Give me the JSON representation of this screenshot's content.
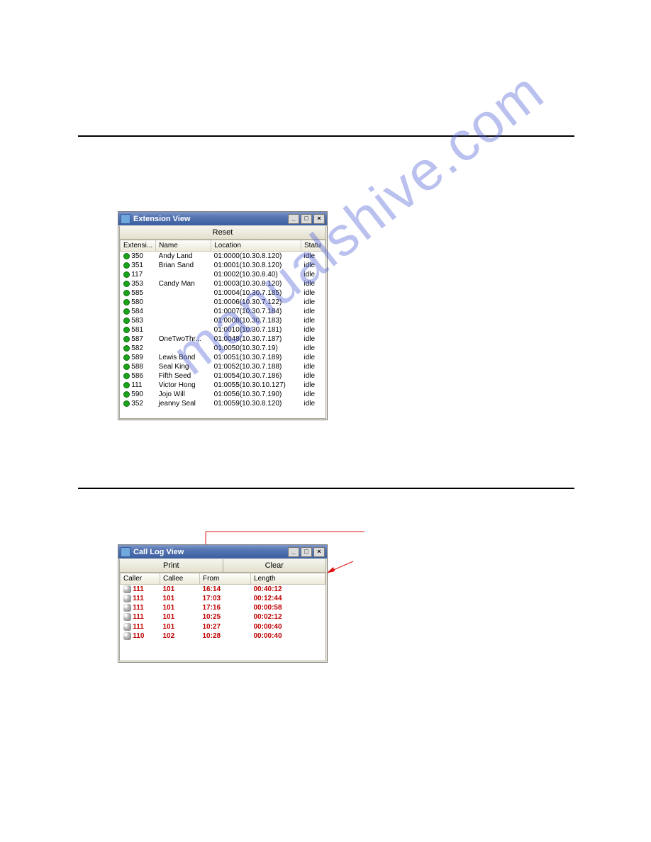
{
  "watermark": "manualshive.com",
  "extWindow": {
    "title": "Extension View",
    "resetLabel": "Reset",
    "headers": [
      "Extensi...",
      "Name",
      "Location",
      "Statu"
    ],
    "rows": [
      {
        "ext": "350",
        "name": "Andy Land",
        "loc": "01:0000(10.30.8.120)",
        "stat": "idle"
      },
      {
        "ext": "351",
        "name": "Brian Sand",
        "loc": "01:0001(10.30.8.120)",
        "stat": "idle"
      },
      {
        "ext": "117",
        "name": "",
        "loc": "01:0002(10.30.8.40)",
        "stat": "idle"
      },
      {
        "ext": "353",
        "name": "Candy Man",
        "loc": "01:0003(10.30.8.120)",
        "stat": "idle"
      },
      {
        "ext": "585",
        "name": "",
        "loc": "01:0004(10.30.7.185)",
        "stat": "idle"
      },
      {
        "ext": "580",
        "name": "",
        "loc": "01:0006(10.30.7.122)",
        "stat": "idle"
      },
      {
        "ext": "584",
        "name": "",
        "loc": "01:0007(10.30.7.184)",
        "stat": "idle"
      },
      {
        "ext": "583",
        "name": "",
        "loc": "01:0008(10.30.7.183)",
        "stat": "idle"
      },
      {
        "ext": "581",
        "name": "",
        "loc": "01:0010(10.30.7.181)",
        "stat": "idle"
      },
      {
        "ext": "587",
        "name": "OneTwoThr...",
        "loc": "01:0048(10.30.7.187)",
        "stat": "idle"
      },
      {
        "ext": "582",
        "name": "",
        "loc": "01:0050(10.30.7.19)",
        "stat": "idle"
      },
      {
        "ext": "589",
        "name": "Lewis Bond",
        "loc": "01:0051(10.30.7.189)",
        "stat": "idle"
      },
      {
        "ext": "588",
        "name": "Seal King",
        "loc": "01:0052(10.30.7.188)",
        "stat": "idle"
      },
      {
        "ext": "586",
        "name": "Fifth Seed",
        "loc": "01:0054(10.30.7.186)",
        "stat": "idle"
      },
      {
        "ext": "111",
        "name": "Victor Hong",
        "loc": "01:0055(10.30.10.127)",
        "stat": "idle"
      },
      {
        "ext": "590",
        "name": "Jojo Will",
        "loc": "01:0056(10.30.7.190)",
        "stat": "idle"
      },
      {
        "ext": "352",
        "name": "jeanny Seal",
        "loc": "01:0059(10.30.8.120)",
        "stat": "idle"
      }
    ]
  },
  "callWindow": {
    "title": "Call Log View",
    "printLabel": "Print",
    "clearLabel": "Clear",
    "headers": [
      "Caller",
      "Callee",
      "From",
      "Length"
    ],
    "rows": [
      {
        "caller": "111",
        "callee": "101",
        "from": "16:14",
        "length": "00:40:12"
      },
      {
        "caller": "111",
        "callee": "101",
        "from": "17:03",
        "length": "00:12:44"
      },
      {
        "caller": "111",
        "callee": "101",
        "from": "17:16",
        "length": "00:00:58"
      },
      {
        "caller": "111",
        "callee": "101",
        "from": "10:25",
        "length": "00:02:12"
      },
      {
        "caller": "111",
        "callee": "101",
        "from": "10:27",
        "length": "00:00:40"
      },
      {
        "caller": "110",
        "callee": "102",
        "from": "10:28",
        "length": "00:00:40"
      }
    ]
  },
  "winButtons": {
    "min": "_",
    "max": "□",
    "close": "×"
  }
}
